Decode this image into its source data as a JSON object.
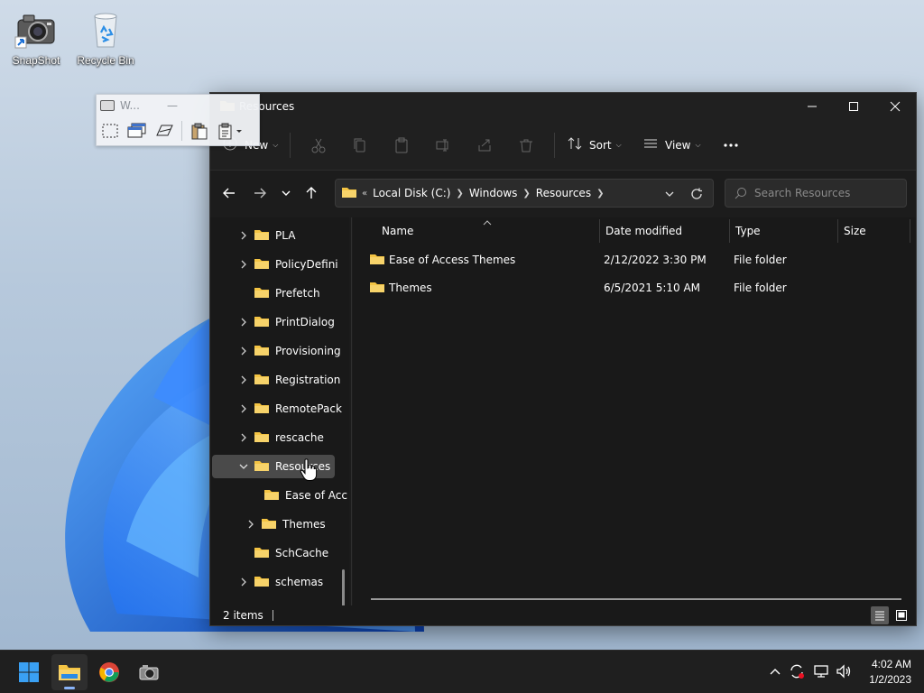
{
  "desktop": {
    "icons": [
      {
        "label": "SnapShot"
      },
      {
        "label": "Recycle Bin"
      }
    ]
  },
  "snapshot_toolbar": {
    "title": "W..."
  },
  "window": {
    "title": "Resources",
    "commands": {
      "new_label": "New",
      "sort_label": "Sort",
      "view_label": "View"
    },
    "breadcrumbs": [
      "Local Disk (C:)",
      "Windows",
      "Resources"
    ],
    "search_placeholder": "Search Resources",
    "tree": [
      {
        "label": "PLA",
        "expand": "collapsed"
      },
      {
        "label": "PolicyDefini",
        "expand": "collapsed"
      },
      {
        "label": "Prefetch",
        "expand": "none"
      },
      {
        "label": "PrintDialog",
        "expand": "collapsed"
      },
      {
        "label": "Provisioning",
        "expand": "collapsed"
      },
      {
        "label": "Registration",
        "expand": "collapsed"
      },
      {
        "label": "RemotePack",
        "expand": "collapsed"
      },
      {
        "label": "rescache",
        "expand": "collapsed"
      },
      {
        "label": "Resources",
        "expand": "expanded",
        "selected": true
      },
      {
        "label": "Ease of Acc",
        "expand": "none",
        "child": true
      },
      {
        "label": "Themes",
        "expand": "collapsed",
        "child": true
      },
      {
        "label": "SchCache",
        "expand": "none"
      },
      {
        "label": "schemas",
        "expand": "collapsed"
      }
    ],
    "columns": {
      "name": "Name",
      "date_modified": "Date modified",
      "type": "Type",
      "size": "Size"
    },
    "files": [
      {
        "name": "Ease of Access Themes",
        "date_modified": "2/12/2022 3:30 PM",
        "type": "File folder",
        "size": ""
      },
      {
        "name": "Themes",
        "date_modified": "6/5/2021 5:10 AM",
        "type": "File folder",
        "size": ""
      }
    ],
    "status": {
      "item_count": "2 items"
    }
  },
  "taskbar": {
    "time": "4:02 AM",
    "date": "1/2/2023"
  },
  "colors": {
    "folder": "#f4c443",
    "folder_dark": "#d9a521",
    "accent": "#0078d4"
  }
}
